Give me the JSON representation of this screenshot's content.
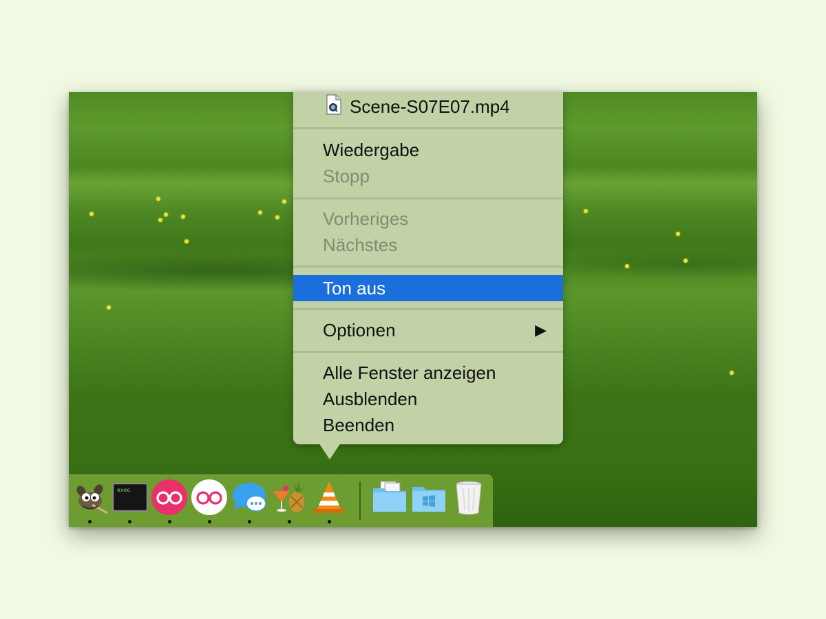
{
  "menu": {
    "file_title": "Scene-S07E07.mp4",
    "items": [
      {
        "label": "Wiedergabe",
        "enabled": true
      },
      {
        "label": "Stopp",
        "enabled": false
      },
      {
        "label": "Vorheriges",
        "enabled": false
      },
      {
        "label": "Nächstes",
        "enabled": false
      },
      {
        "label": "Ton aus",
        "enabled": true,
        "highlighted": true
      },
      {
        "label": "Optionen",
        "enabled": true,
        "submenu": true
      },
      {
        "label": "Alle Fenster anzeigen",
        "enabled": true
      },
      {
        "label": "Ausblenden",
        "enabled": true
      },
      {
        "label": "Beenden",
        "enabled": true
      }
    ],
    "submenu_arrow": "▶",
    "highlight_color": "#1b6fdc"
  },
  "dock": {
    "apps": [
      {
        "icon": "gimp-icon",
        "running": true
      },
      {
        "icon": "terminal-icon",
        "running": true,
        "text": "exec"
      },
      {
        "icon": "flickr-pink-icon",
        "running": true
      },
      {
        "icon": "flickr-white-icon",
        "running": true
      },
      {
        "icon": "messages-icon",
        "running": true
      },
      {
        "icon": "cocktail-pineapple-icon",
        "running": true
      },
      {
        "icon": "vlc-cone-icon",
        "running": true
      }
    ],
    "stacks": [
      {
        "icon": "documents-folder-icon"
      },
      {
        "icon": "windows-folder-icon"
      },
      {
        "icon": "trash-icon"
      }
    ]
  }
}
